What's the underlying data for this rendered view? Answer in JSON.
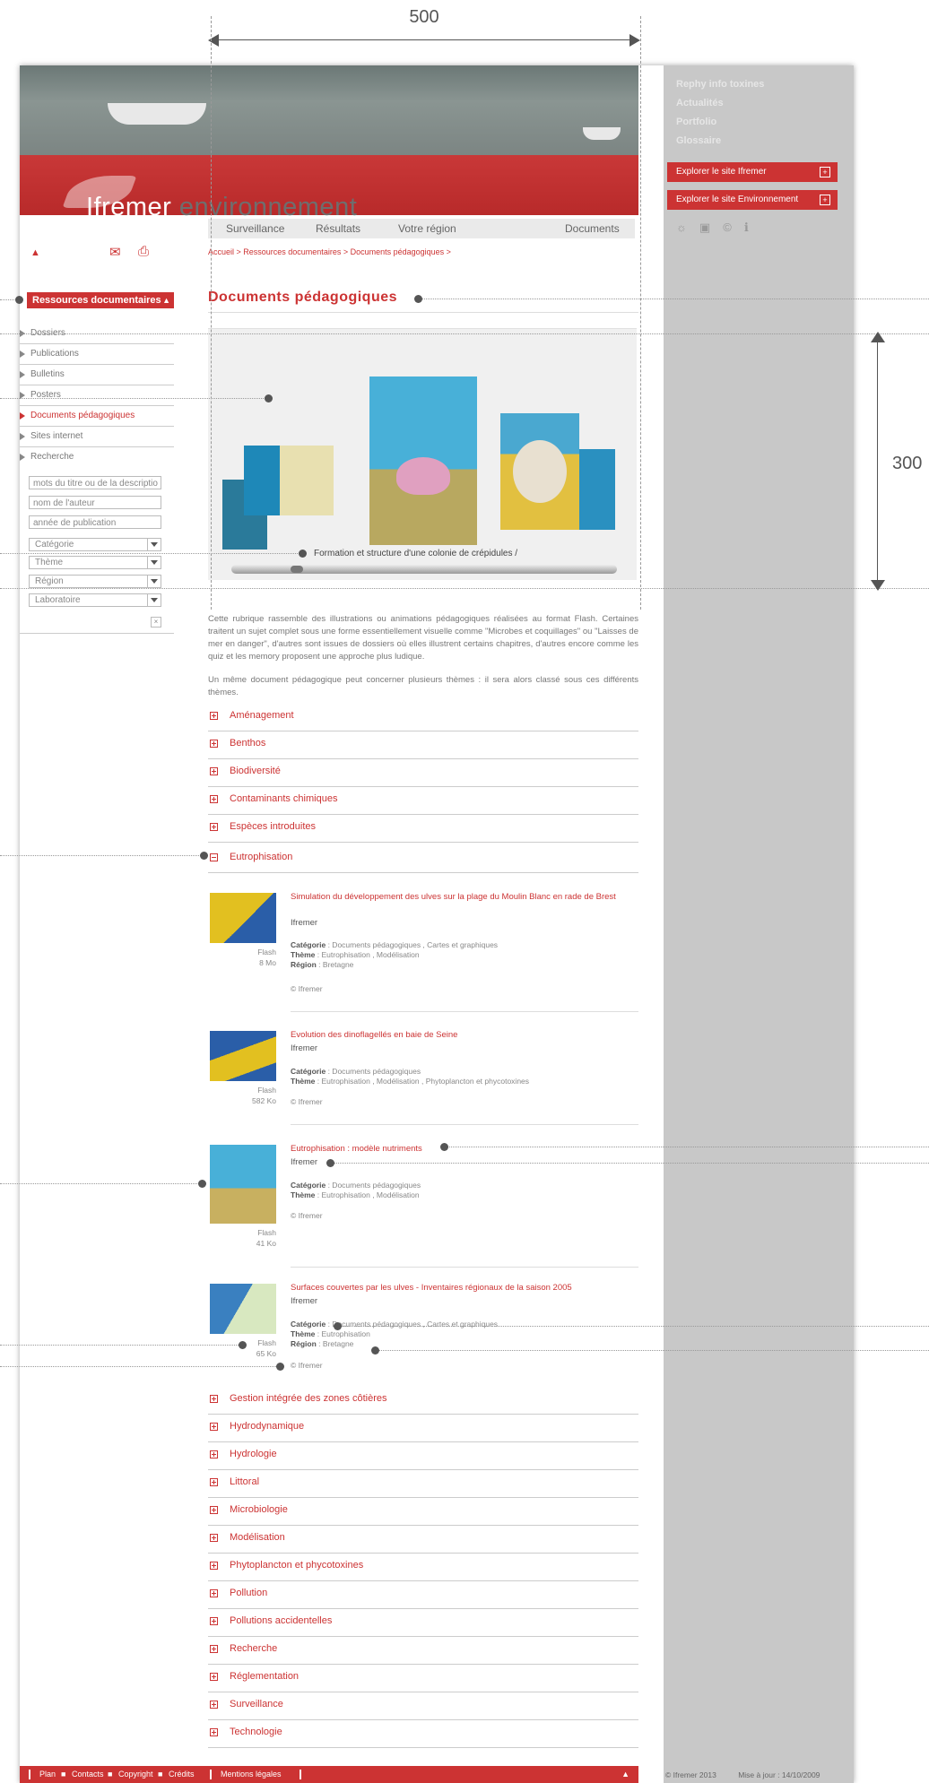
{
  "annotations": {
    "width_label": "500",
    "height_label": "300"
  },
  "brand": {
    "main": "Ifremer",
    "sub": "environnement"
  },
  "right_menu": [
    "Rephy info toxines",
    "Actualités",
    "Portfolio",
    "Glossaire"
  ],
  "right_buttons": [
    "Explorer le site Ifremer",
    "Explorer le site Environnement"
  ],
  "right_icons": [
    "☼",
    "▣",
    "©",
    "ℹ"
  ],
  "top_nav": [
    "Surveillance",
    "Résultats",
    "Votre région",
    "Documents"
  ],
  "toolbar": {
    "up": "▲",
    "mail": "✉",
    "print": "⎙"
  },
  "breadcrumb": "Accueil > Ressources documentaires > Documents pédagogiques >",
  "sidebar": {
    "heading": "Ressources documentaires",
    "items": [
      "Dossiers",
      "Publications",
      "Bulletins",
      "Posters",
      "Documents pédagogiques",
      "Sites internet",
      "Recherche"
    ],
    "search_fields": [
      "mots du titre ou de la descriptio",
      "nom de l'auteur",
      "année de publication"
    ],
    "selects": [
      "Catégorie",
      "Thème",
      "Région",
      "Laboratoire"
    ],
    "submit": "×"
  },
  "page_title": "Documents pédagogiques",
  "viewer_caption": "Formation et structure d'une colonie de crépidules /",
  "intro": [
    "Cette rubrique rassemble des illustrations ou animations pédagogiques réalisées au format Flash. Certaines traitent un sujet complet sous une forme essentiellement visuelle comme \"Microbes et coquillages\" ou \"Laisses de mer en danger\", d'autres sont issues de dossiers où elles illustrent certains chapitres, d'autres encore comme les quiz et les memory proposent une approche plus ludique.",
    "Un même document pédagogique peut concerner plusieurs thèmes : il sera alors classé sous ces différents thèmes."
  ],
  "categories_before": [
    "Aménagement",
    "Benthos",
    "Biodiversité",
    "Contaminants chimiques",
    "Espèces introduites"
  ],
  "open_category": "Eutrophisation",
  "documents": [
    {
      "title": "Simulation du développement des ulves sur la plage du Moulin Blanc en rade de Brest",
      "org": "Ifremer",
      "cat_label": "Catégorie",
      "cat": " : Documents pédagogiques ,  Cartes et graphiques",
      "theme_label": "Thème",
      "theme": " : Eutrophisation ,  Modélisation",
      "region_label": "Région",
      "region": " : Bretagne",
      "copy": "© Ifremer",
      "format": "Flash",
      "size": "8 Mo"
    },
    {
      "title": "Evolution des dinoflagellés en baie de Seine",
      "org": "Ifremer",
      "cat_label": "Catégorie",
      "cat": " : Documents pédagogiques",
      "theme_label": "Thème",
      "theme": " : Eutrophisation ,  Modélisation ,  Phytoplancton et phycotoxines",
      "region_label": "",
      "region": "",
      "copy": "© Ifremer",
      "format": "Flash",
      "size": "582 Ko"
    },
    {
      "title": "Eutrophisation : modèle nutriments",
      "org": "Ifremer",
      "cat_label": "Catégorie",
      "cat": " : Documents pédagogiques",
      "theme_label": "Thème",
      "theme": " : Eutrophisation ,  Modélisation",
      "region_label": "",
      "region": "",
      "copy": "© Ifremer",
      "format": "Flash",
      "size": "41 Ko"
    },
    {
      "title": "Surfaces couvertes par les ulves - Inventaires régionaux de la saison 2005",
      "org": "Ifremer",
      "cat_label": "Catégorie",
      "cat": " : Documents pédagogiques ,  Cartes et graphiques",
      "theme_label": "Thème",
      "theme": " : Eutrophisation",
      "region_label": "Région",
      "region": " : Bretagne",
      "copy": "© Ifremer",
      "format": "Flash",
      "size": "65 Ko"
    }
  ],
  "categories_after": [
    "Gestion intégrée des zones côtières",
    "Hydrodynamique",
    "Hydrologie",
    "Littoral",
    "Microbiologie",
    "Modélisation",
    "Phytoplancton et phycotoxines",
    "Pollution",
    "Pollutions accidentelles",
    "Recherche",
    "Réglementation",
    "Surveillance",
    "Technologie"
  ],
  "footer": {
    "links": [
      "Plan",
      "Contacts",
      "Copyright",
      "Crédits"
    ],
    "legal": "Mentions légales",
    "up": "▲"
  },
  "footer_right": {
    "copyright": "© Ifremer 2013",
    "updated": "Mise à jour : 14/10/2009"
  },
  "colors": {
    "accent": "#cc3333",
    "sidebar_grey": "#c8c8c8"
  }
}
